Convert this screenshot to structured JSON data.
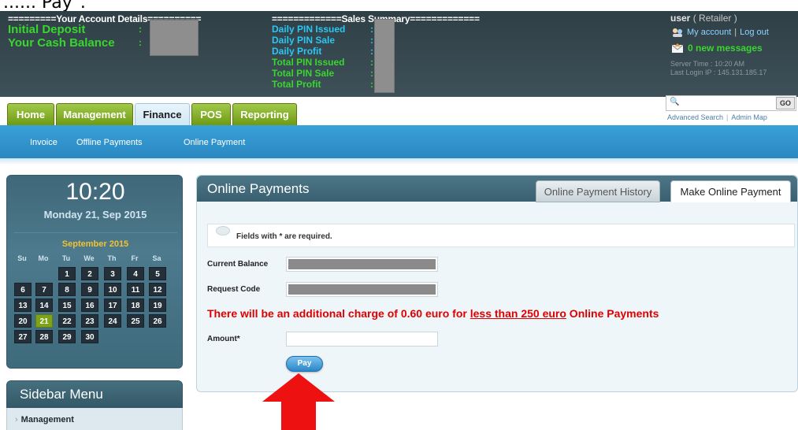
{
  "caption": "...... Pay\".",
  "header": {
    "account_title": "=========Your Account Details==========",
    "sales_title": "=============Sales Summary=============",
    "initial_deposit": "Initial Deposit",
    "cash_balance": "Your Cash Balance",
    "sales": {
      "daily_pin_issued": "Daily PIN Issued",
      "daily_pin_sale": "Daily PIN Sale",
      "daily_profit": "Daily Profit",
      "total_pin_issued": "Total PIN Issued",
      "total_pin_sale": "Total PIN Sale",
      "total_profit": "Total Profit"
    },
    "colon": ":",
    "user_name": "user",
    "user_role": "( Retailer )",
    "my_account": "My account",
    "link_sep": "|",
    "logout": "Log out",
    "messages": "0 new messages",
    "server_time": "Server Time : 10:20 AM",
    "last_login": "Last Login IP : 145.131.185.17"
  },
  "search": {
    "placeholder": "",
    "go_label": "GO",
    "search_icon": "🔍",
    "advanced": "Advanced Search",
    "sep": "|",
    "admin_map": "Admin Map"
  },
  "tabs": {
    "home": "Home",
    "management": "Management",
    "finance": "Finance",
    "pos": "POS",
    "reporting": "Reporting"
  },
  "subnav": {
    "invoice": "Invoice",
    "offline": "Offline Payments",
    "online": "Online Payment"
  },
  "clock": {
    "time": "10:20",
    "date": "Monday 21, Sep 2015"
  },
  "calendar": {
    "month": "September 2015",
    "dow": [
      "Su",
      "Mo",
      "Tu",
      "We",
      "Th",
      "Fr",
      "Sa"
    ],
    "days": [
      "1",
      "2",
      "3",
      "4",
      "5",
      "6",
      "7",
      "8",
      "9",
      "10",
      "11",
      "12",
      "13",
      "14",
      "15",
      "16",
      "17",
      "18",
      "19",
      "20",
      "21",
      "22",
      "23",
      "24",
      "25",
      "26",
      "27",
      "28",
      "29",
      "30"
    ],
    "today": "21"
  },
  "sidebar": {
    "title": "Sidebar Menu",
    "chevron": "›",
    "items": [
      {
        "label": "Management"
      }
    ]
  },
  "panel": {
    "title": "Online Payments",
    "tab_history": "Online Payment History",
    "tab_make": "Make Online Payment",
    "notice": "Fields with * are required.",
    "current_balance_label": "Current Balance",
    "request_code_label": "Request Code",
    "charge_prefix": "There will be an additional charge of 0.60 euro for ",
    "charge_underlined": "less than 250 euro",
    "charge_suffix": " Online Payments",
    "amount_label": "Amount*",
    "amount_value": "",
    "pay_label": "Pay"
  },
  "colors": {
    "tab_green": "#7ea319",
    "subnav_blue": "#2f94cd",
    "charge_red": "#e00000",
    "arrow_red": "#ee1111"
  }
}
